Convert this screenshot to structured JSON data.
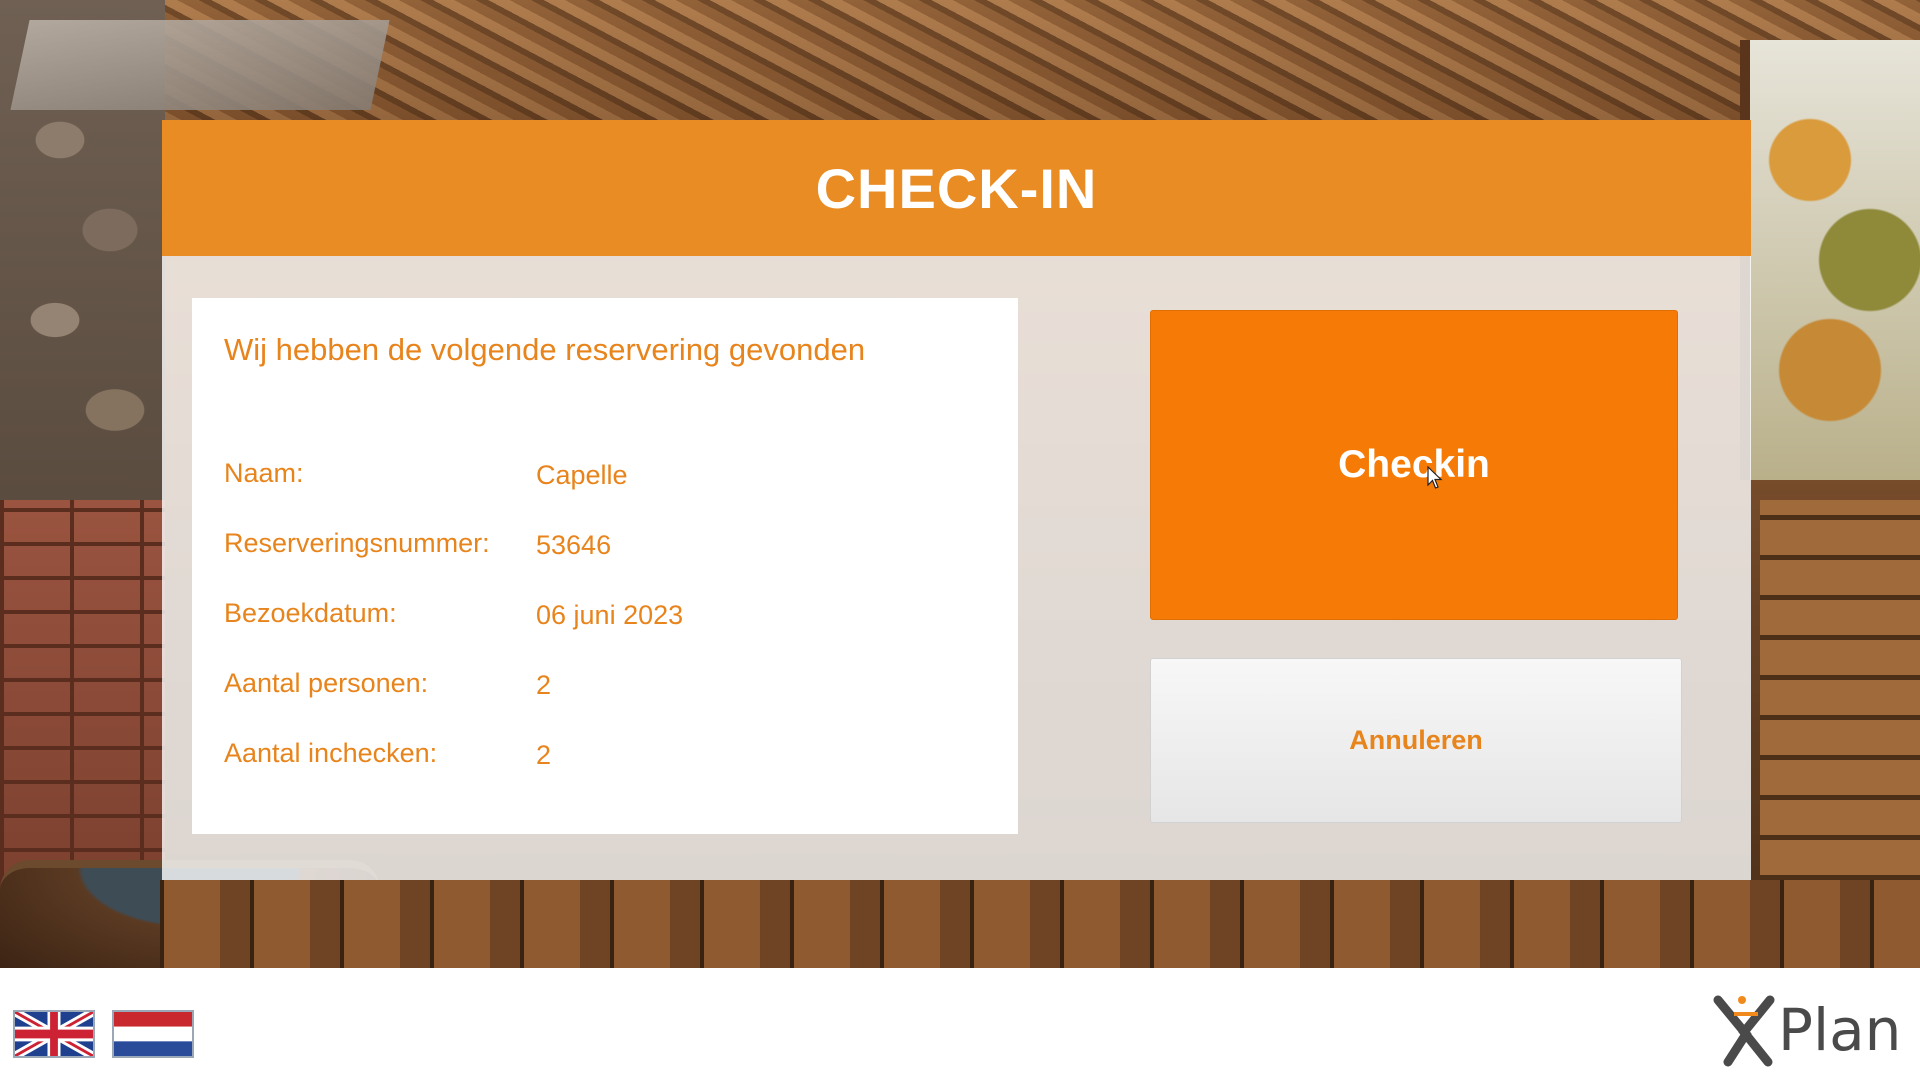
{
  "header": {
    "title": "CHECK-IN"
  },
  "reservation": {
    "heading": "Wij hebben de volgende reservering gevonden",
    "rows": [
      {
        "label": "Naam:",
        "value": "Capelle"
      },
      {
        "label": "Reserveringsnummer:",
        "value": "53646"
      },
      {
        "label": "Bezoekdatum:",
        "value": "06 juni 2023"
      },
      {
        "label": "Aantal personen:",
        "value": "2"
      },
      {
        "label": "Aantal inchecken:",
        "value": "2"
      }
    ]
  },
  "actions": {
    "checkin_label": "Checkin",
    "cancel_label": "Annuleren"
  },
  "footer": {
    "languages": [
      {
        "name": "English",
        "icon": "uk-flag-icon"
      },
      {
        "name": "Nederlands",
        "icon": "nl-flag-icon"
      }
    ],
    "logo_text": "Plan"
  },
  "colors": {
    "accent": "#e98c24",
    "button": "#f57b06",
    "text_accent": "#e8841c"
  }
}
